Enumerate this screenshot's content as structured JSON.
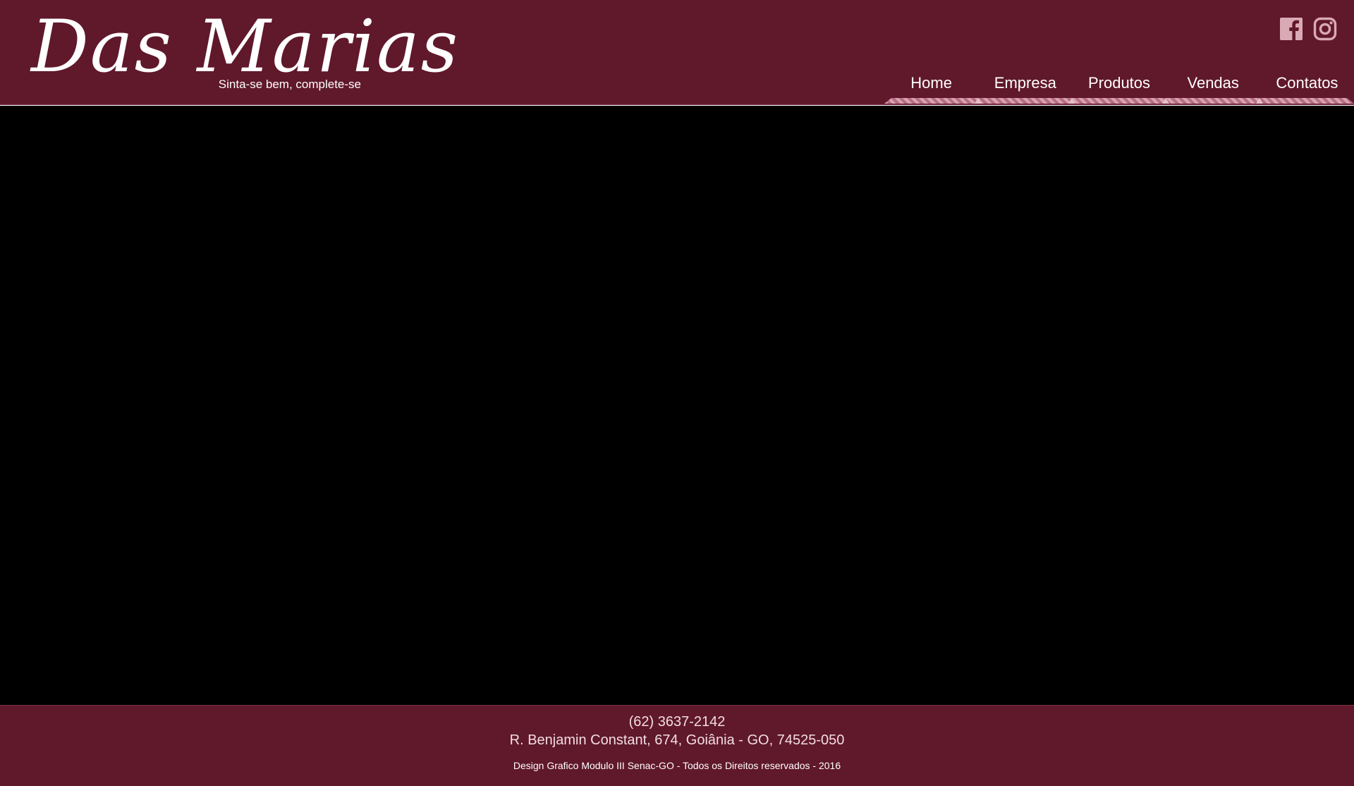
{
  "header": {
    "brand": {
      "name": "Das Marias",
      "tagline": "Sinta-se bem, complete-se"
    },
    "social": [
      {
        "name": "facebook",
        "icon": "facebook-icon"
      },
      {
        "name": "instagram",
        "icon": "instagram-icon"
      }
    ],
    "nav": {
      "items": [
        {
          "label": "Home"
        },
        {
          "label": "Empresa"
        },
        {
          "label": "Produtos"
        },
        {
          "label": "Vendas"
        },
        {
          "label": "Contatos"
        }
      ]
    }
  },
  "footer": {
    "phone": "(62) 3637-2142",
    "address": "R. Benjamin Constant, 674, Goiânia - GO, 74525-050",
    "credits": "Design Grafico Modulo III Senac-GO - Todos os Direitos reservados - 2016"
  },
  "colors": {
    "brand_wine": "#60182b",
    "trim_pink": "#d8a3b2",
    "hero_background": "#000000",
    "text_light": "#ffffff"
  }
}
